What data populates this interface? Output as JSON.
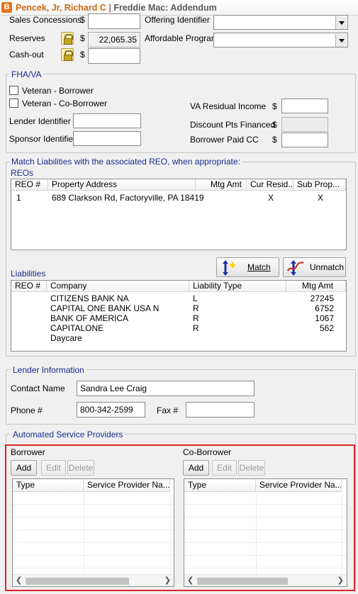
{
  "title": {
    "badge": "B",
    "borrower": "Pencek, Jr, Richard C",
    "separator": "|",
    "form": "Freddie Mac: Addendum"
  },
  "top": {
    "sales_concessions_label": "Sales Concessions",
    "sales_concessions_currency": "$",
    "sales_concessions_value": "",
    "reserves_label": "Reserves",
    "reserves_currency": "$",
    "reserves_value": "22,065.35",
    "cashout_label": "Cash-out",
    "cashout_currency": "$",
    "cashout_value": "",
    "offering_identifier_label": "Offering Identifier",
    "offering_identifier_value": "",
    "affordable_program_label": "Affordable Program",
    "affordable_program_value": ""
  },
  "fha": {
    "title": "FHA/VA",
    "veteran_borrower": "Veteran - Borrower",
    "veteran_coborrower": "Veteran - Co-Borrower",
    "lender_identifier_label": "Lender Identifier",
    "lender_identifier_value": "",
    "sponsor_identifier_label": "Sponsor Identifier",
    "sponsor_identifier_value": "",
    "va_residual_label": "VA Residual Income",
    "va_residual_currency": "$",
    "va_residual_value": "",
    "discount_pts_label": "Discount Pts Financed",
    "discount_pts_currency": "$",
    "discount_pts_value": "",
    "borrower_paid_label": "Borrower Paid CC",
    "borrower_paid_currency": "$",
    "borrower_paid_value": ""
  },
  "match": {
    "title": "Match Liabilities with the associated REO, when appropriate:",
    "reos_label": "REOs",
    "reo_headers": [
      "REO #",
      "Property Address",
      "Mtg Amt",
      "Cur Resid...",
      "Sub Prop..."
    ],
    "reo_rows": [
      {
        "num": "1",
        "address": "689 Clarkson Rd, Factoryville, PA 18419",
        "mtg": "",
        "cur": "X",
        "sub": "X"
      }
    ],
    "match_button": "Match",
    "unmatch_button": "Unmatch",
    "liabilities_label": "Liabilities",
    "liab_headers": [
      "REO #",
      "Company",
      "Liability Type",
      "Mtg Amt"
    ],
    "liab_rows": [
      {
        "reo": "",
        "company": "CITIZENS BANK NA",
        "type": "L",
        "amt": "27245"
      },
      {
        "reo": "",
        "company": "CAPITAL ONE BANK USA N",
        "type": "R",
        "amt": "6752"
      },
      {
        "reo": "",
        "company": "BANK OF AMERICA",
        "type": "R",
        "amt": "1067"
      },
      {
        "reo": "",
        "company": "CAPITALONE",
        "type": "R",
        "amt": "562"
      },
      {
        "reo": "",
        "company": "Daycare",
        "type": "",
        "amt": ""
      }
    ]
  },
  "lender": {
    "title": "Lender Information",
    "contact_label": "Contact Name",
    "contact_value": "Sandra Lee Craig",
    "phone_label": "Phone #",
    "phone_value": "800-342-2599",
    "fax_label": "Fax #",
    "fax_value": ""
  },
  "asp": {
    "title": "Automated Service Providers",
    "borrower": {
      "label": "Borrower",
      "add": "Add",
      "edit": "Edit",
      "delete": "Delete",
      "headers": [
        "Type",
        "Service Provider Na..."
      ]
    },
    "coborrower": {
      "label": "Co-Borrower",
      "add": "Add",
      "edit": "Edit",
      "delete": "Delete",
      "headers": [
        "Type",
        "Service Provider Na..."
      ]
    }
  },
  "colors": {
    "accent_orange": "#e8731a",
    "group_title_blue": "#1a2a8c",
    "highlight_red": "#e0242b"
  }
}
